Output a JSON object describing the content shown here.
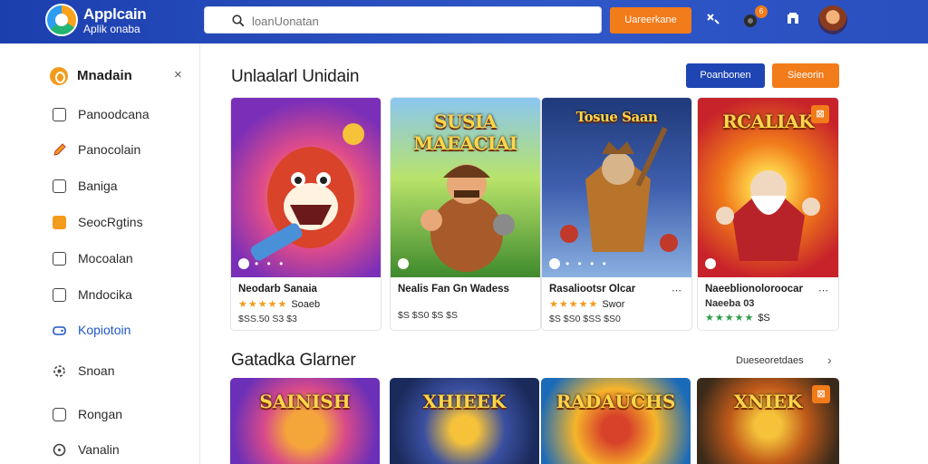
{
  "header": {
    "logo_title": "Applcain",
    "logo_subtitle": "Aplik onaba",
    "search_placeholder": "loanUonatan",
    "primary_button": "Uareerkane",
    "notification_count": "6"
  },
  "sidebar": {
    "heading": "Mnadain",
    "items": [
      {
        "label": "Panoodcana",
        "icon": "square-icon"
      },
      {
        "label": "Panocolain",
        "icon": "pencil-icon"
      },
      {
        "label": "Baniga",
        "icon": "file-icon"
      },
      {
        "label": "SeocRgtins",
        "icon": "folder-icon"
      },
      {
        "label": "Mocoalan",
        "icon": "document-icon"
      },
      {
        "label": "Mndocika",
        "icon": "minus-box-icon"
      },
      {
        "label": "Kopiotoin",
        "icon": "gamepad-icon"
      },
      {
        "label": "Snoan",
        "icon": "settings-icon"
      },
      {
        "label": "Rongan",
        "icon": "circle-box-icon"
      },
      {
        "label": "Vanalin",
        "icon": "info-icon"
      }
    ]
  },
  "main": {
    "section1_title": "Unlaalarl Unidain",
    "btn_blue": "Poanbonen",
    "btn_orange": "Sieeorin",
    "cards": [
      {
        "art_title": "",
        "name": "Neodarb Sanaia",
        "stars": "★★★★★",
        "rating_text": "Soaeb",
        "meta": "$SS.50 S3 $3",
        "colors": [
          "#7b2fb8",
          "#e04c8a",
          "#f3a23a"
        ]
      },
      {
        "art_title": "SUSIA MAEACIAI",
        "name": "Nealis Fan Gn Wadess",
        "stars": "",
        "rating_text": "",
        "meta": "$S $S0 $S $S",
        "colors": [
          "#3f8a2d",
          "#7bbf4a",
          "#b8e36a"
        ]
      },
      {
        "art_title": "Tosue Saan",
        "name": "Rasaliootsr Olcar",
        "stars": "★★★★★",
        "rating_text": "Swor",
        "meta": "$S $S0 $SS $S0",
        "colors": [
          "#1f3a7a",
          "#3f5fae",
          "#8ab0e0"
        ]
      },
      {
        "art_title": "RCALIAK",
        "name": "Naeeblionoloroocar",
        "stars": "★★★★★",
        "rating_text": "$S",
        "rating_prefix": "Naeeba 03",
        "meta": "",
        "colors": [
          "#c8232a",
          "#f07a1a",
          "#ffd24a"
        ]
      }
    ],
    "section2_title": "Gatadka Glarner",
    "see_all": "Dueseoretdaes",
    "cards2": [
      {
        "art_title": "SAINISH",
        "colors": [
          "#6b2fb8",
          "#d84a8a",
          "#f5a63a"
        ]
      },
      {
        "art_title": "XHIEEK",
        "colors": [
          "#1a2a5a",
          "#3a4fa0",
          "#f5c23a"
        ]
      },
      {
        "art_title": "RADAUCHS",
        "colors": [
          "#1c6bb8",
          "#f5b52a",
          "#d8422a"
        ]
      },
      {
        "art_title": "XNIEK",
        "colors": [
          "#3a2a1a",
          "#c05a1a",
          "#f5c23a"
        ]
      }
    ]
  }
}
